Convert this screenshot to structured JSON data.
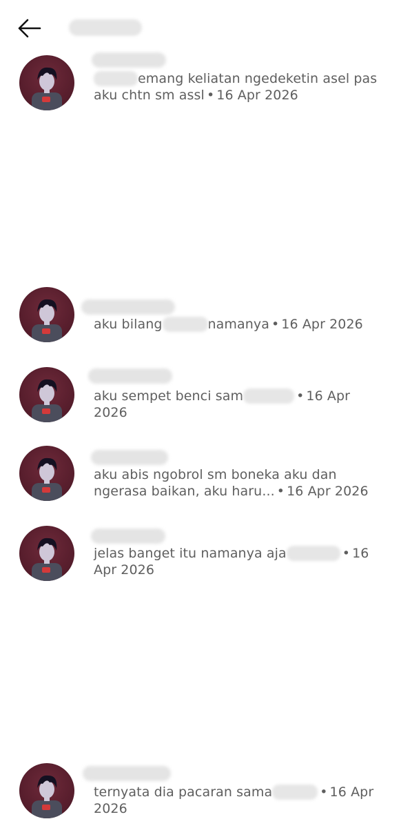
{
  "header": {
    "back_icon": "arrow-left-icon"
  },
  "notifications": [
    {
      "text_after": "emang keliatan ngedeketin asel pas aku chtn sm assl",
      "date": "16 Apr 2026"
    },
    {
      "text_before": "aku bilang",
      "text_after": "namanya",
      "date": "16 Apr 2026"
    },
    {
      "text_before": "aku sempet benci sam",
      "date": "16 Apr 2026"
    },
    {
      "text_before": "aku abis ngobrol sm boneka aku dan ngerasa baikan, aku haru...",
      "date": "16 Apr 2026"
    },
    {
      "text_before": "jelas banget itu namanya aja",
      "date": "16 Apr 2026"
    },
    {
      "text_before": "ternyata dia pacaran sama",
      "date": "16 Apr 2026"
    }
  ],
  "separator": "•"
}
